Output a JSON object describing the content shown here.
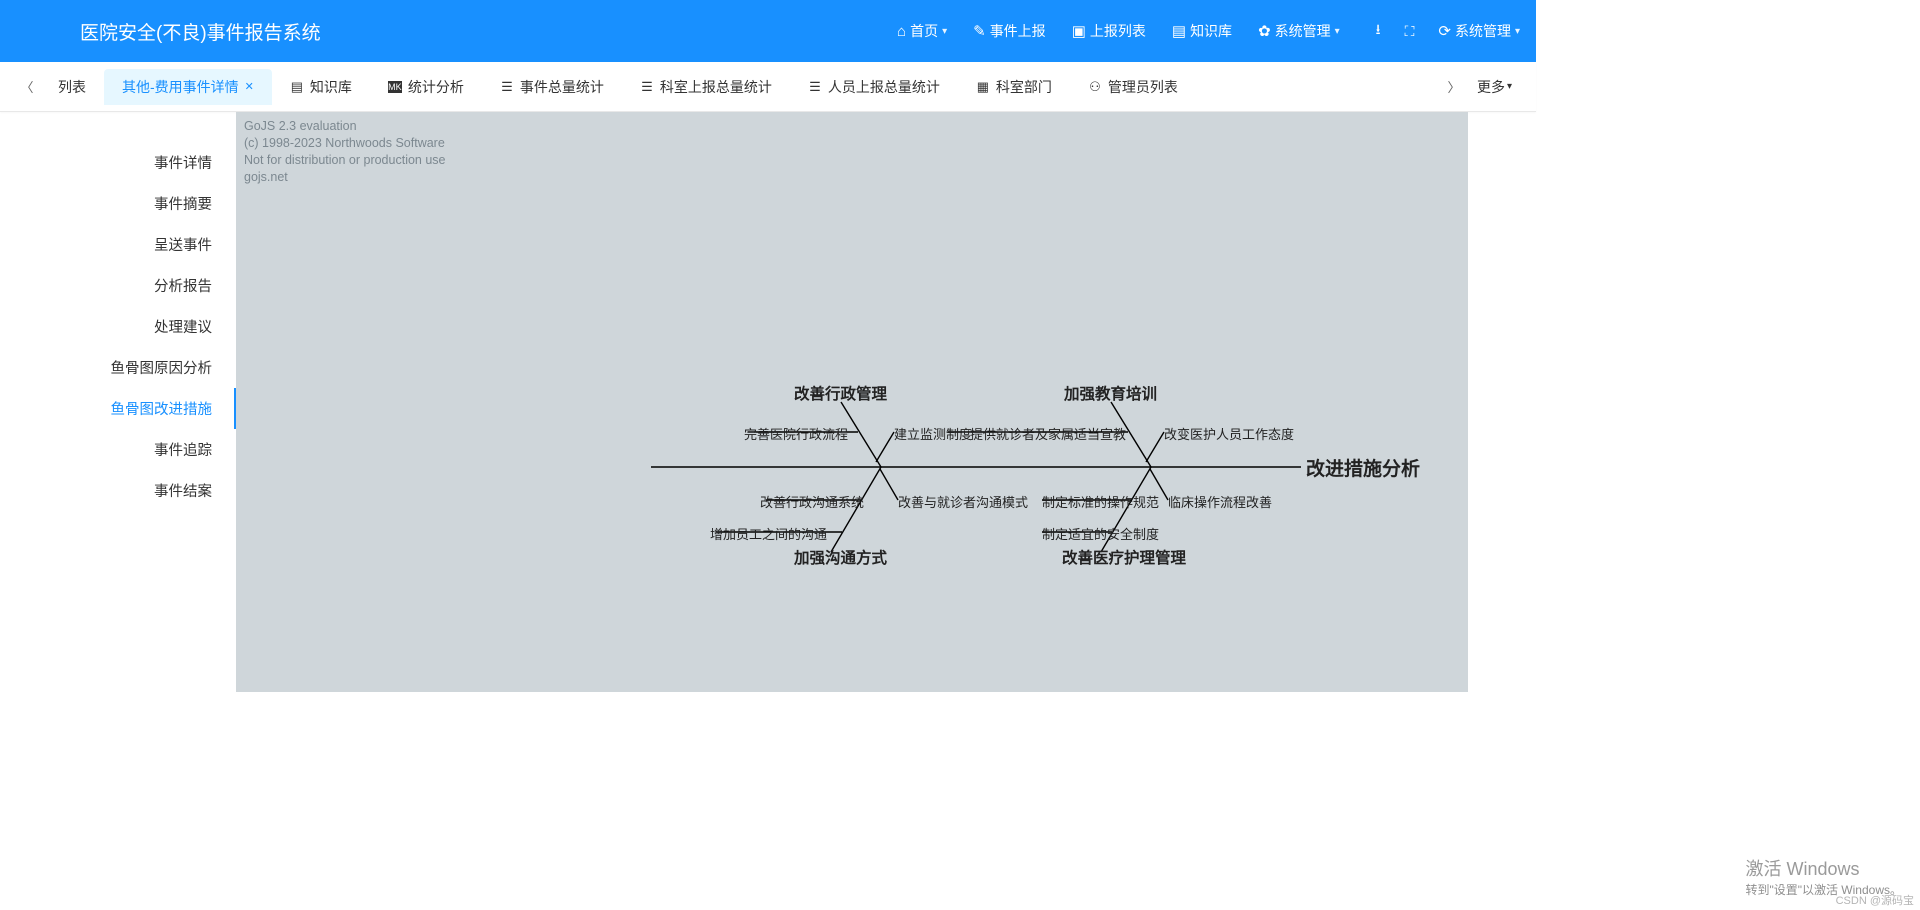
{
  "app_title": "医院安全(不良)事件报告系统",
  "top_nav": [
    {
      "label": "首页",
      "icon": "home-icon",
      "caret": true
    },
    {
      "label": "事件上报",
      "icon": "edit-icon",
      "caret": false
    },
    {
      "label": "上报列表",
      "icon": "grid-icon",
      "caret": false
    },
    {
      "label": "知识库",
      "icon": "book-icon",
      "caret": false
    },
    {
      "label": "系统管理",
      "icon": "gear-icon",
      "caret": true
    }
  ],
  "top_nav_right": {
    "label": "系统管理",
    "icon": "refresh-icon",
    "caret": true
  },
  "tabbar": {
    "tabs": [
      {
        "label": "列表",
        "icon": "",
        "closable": false,
        "active": false
      },
      {
        "label": "其他-费用事件详情",
        "icon": "",
        "closable": true,
        "active": true
      },
      {
        "label": "知识库",
        "icon": "book-icon",
        "closable": false
      },
      {
        "label": "统计分析",
        "icon": "mark-icon",
        "closable": false
      },
      {
        "label": "事件总量统计",
        "icon": "list-icon",
        "closable": false
      },
      {
        "label": "科室上报总量统计",
        "icon": "list-icon",
        "closable": false
      },
      {
        "label": "人员上报总量统计",
        "icon": "list-icon",
        "closable": false
      },
      {
        "label": "科室部门",
        "icon": "dept-icon",
        "closable": false
      },
      {
        "label": "管理员列表",
        "icon": "user-icon",
        "closable": false
      }
    ],
    "more_label": "更多"
  },
  "side_nav": [
    {
      "label": "事件详情",
      "active": false
    },
    {
      "label": "事件摘要",
      "active": false
    },
    {
      "label": "呈送事件",
      "active": false
    },
    {
      "label": "分析报告",
      "active": false
    },
    {
      "label": "处理建议",
      "active": false
    },
    {
      "label": "鱼骨图原因分析",
      "active": false
    },
    {
      "label": "鱼骨图改进措施",
      "active": true
    },
    {
      "label": "事件追踪",
      "active": false
    },
    {
      "label": "事件结案",
      "active": false
    }
  ],
  "watermark": {
    "l1": "GoJS 2.3 evaluation",
    "l2": "(c) 1998-2023 Northwoods Software",
    "l3": "Not for distribution or production use",
    "l4": "gojs.net"
  },
  "fishbone": {
    "head": "改进措施分析",
    "branches": [
      {
        "name": "改善行政管理",
        "dir": "up-left",
        "children": [
          "完善医院行政流程",
          "建立监测制度"
        ]
      },
      {
        "name": "加强教育培训",
        "dir": "up-right",
        "children": [
          "提供就诊者及家属适当宣教",
          "改变医护人员工作态度"
        ]
      },
      {
        "name": "加强沟通方式",
        "dir": "down-left",
        "children": [
          "改善行政沟通系统",
          "改善与就诊者沟通模式",
          "增加员工之间的沟通"
        ]
      },
      {
        "name": "改善医疗护理管理",
        "dir": "down-right",
        "children": [
          "制定标准的操作规范",
          "临床操作流程改善",
          "制定适宜的安全制度"
        ]
      }
    ]
  },
  "activate": {
    "l1": "激活 Windows",
    "l2": "转到\"设置\"以激活 Windows。"
  },
  "credit": "CSDN @源码宝"
}
